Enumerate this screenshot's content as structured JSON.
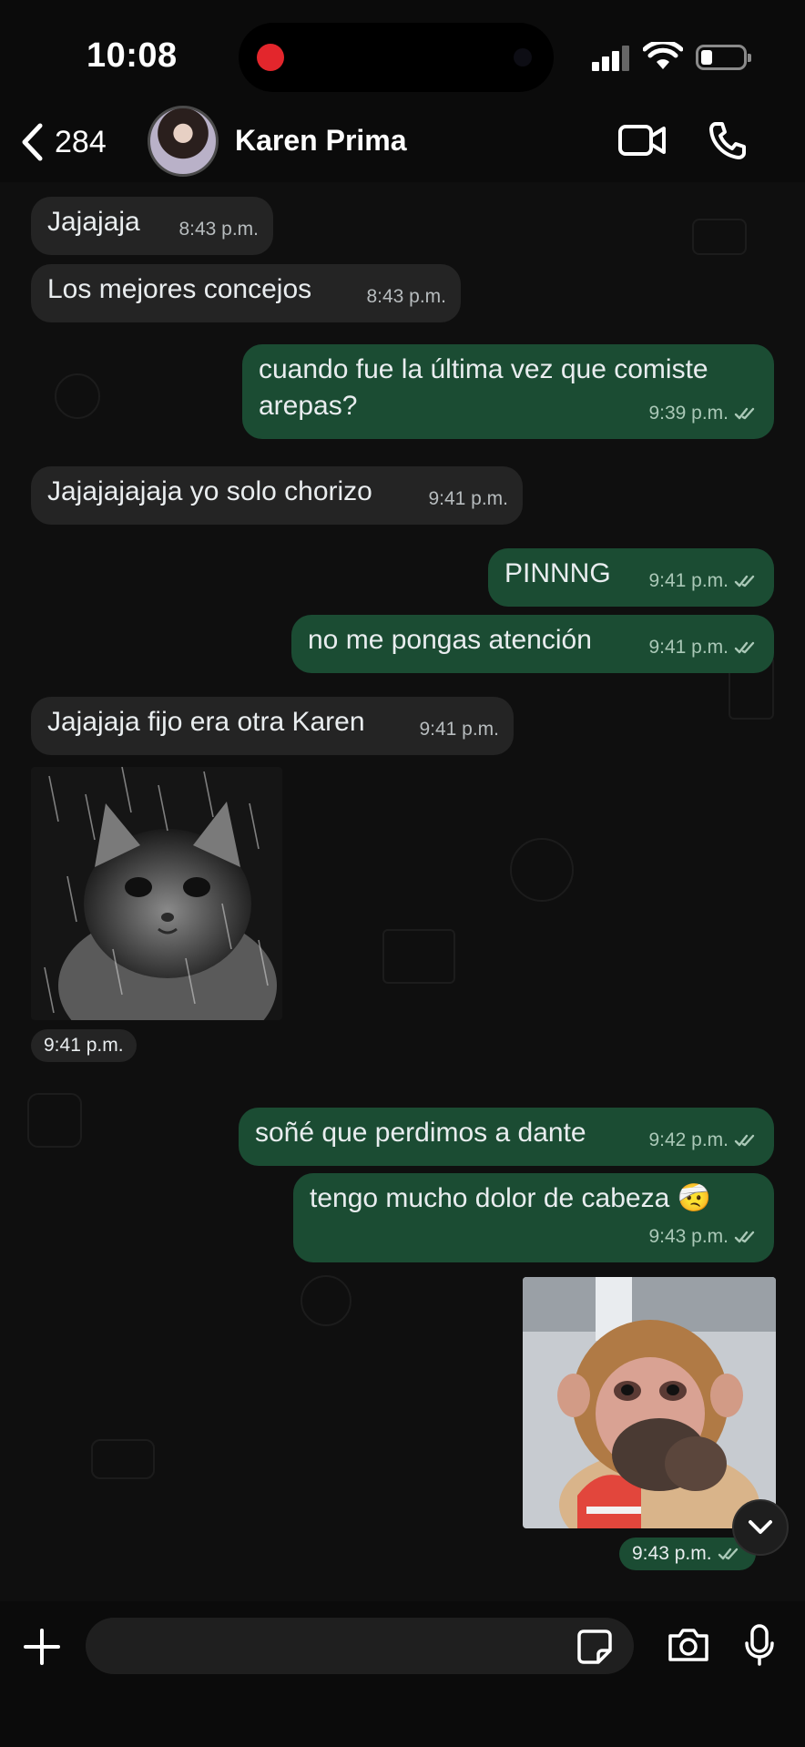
{
  "status_bar": {
    "time": "10:08",
    "recording": true,
    "cellular_icon": "cellular-signal-icon",
    "wifi_icon": "wifi-icon",
    "battery_icon": "battery-low-icon"
  },
  "header": {
    "back_icon": "chevron-left-icon",
    "unread_count": "284",
    "contact_name": "Karen Prima",
    "video_call_icon": "video-camera-icon",
    "voice_call_icon": "phone-icon"
  },
  "messages": [
    {
      "direction": "incoming",
      "text": "Jajajaja",
      "time": "8:43 p.m."
    },
    {
      "direction": "incoming",
      "text": "Los mejores concejos",
      "time": "8:43 p.m."
    },
    {
      "direction": "outgoing",
      "text": "cuando fue la última vez que comiste arepas?",
      "time": "9:39 p.m.",
      "status": "read"
    },
    {
      "direction": "incoming",
      "text": "Jajajajajaja yo solo chorizo",
      "time": "9:41 p.m."
    },
    {
      "direction": "outgoing",
      "text": "PINNNG",
      "time": "9:41 p.m.",
      "status": "read"
    },
    {
      "direction": "outgoing",
      "text": "no me pongas atención",
      "time": "9:41 p.m.",
      "status": "read"
    },
    {
      "direction": "incoming",
      "text": "Jajajaja fijo era otra Karen",
      "time": "9:41 p.m."
    },
    {
      "direction": "incoming",
      "type": "sticker",
      "sticker": "sad crying cat in rain",
      "time": "9:41 p.m."
    },
    {
      "direction": "outgoing",
      "text": "soñé que perdimos a dante",
      "time": "9:42 p.m.",
      "status": "read"
    },
    {
      "direction": "outgoing",
      "text": "tengo mucho dolor de cabeza 🤕",
      "time": "9:43 p.m.",
      "status": "read"
    },
    {
      "direction": "outgoing",
      "type": "sticker",
      "sticker": "monkey covering mouth",
      "time": "9:43 p.m.",
      "status": "read"
    }
  ],
  "scroll_down_icon": "chevron-down-icon",
  "composer": {
    "attach_icon": "plus-icon",
    "input_value": "",
    "sticker_icon": "sticker-icon",
    "camera_icon": "camera-icon",
    "mic_icon": "microphone-icon"
  },
  "colors": {
    "background": "#0b0b0b",
    "incoming_bubble": "#242424",
    "outgoing_bubble": "#1b4c33",
    "recording_dot": "#e3262c"
  }
}
